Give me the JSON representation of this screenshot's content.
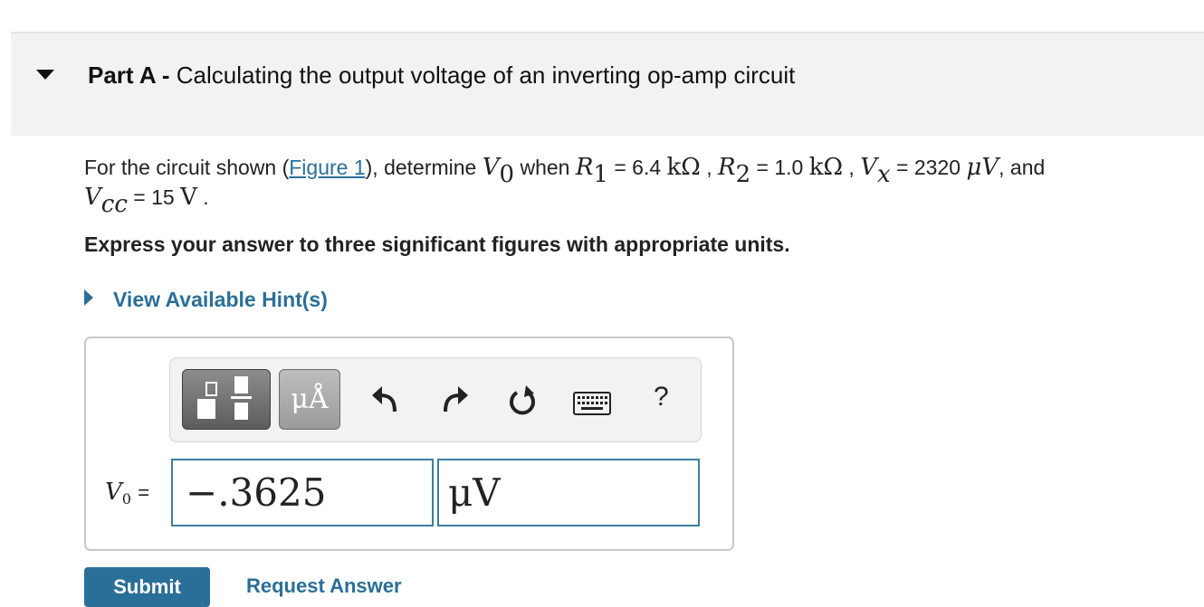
{
  "part": {
    "label": "Part A -",
    "title": "Calculating the output voltage of an inverting op-amp circuit"
  },
  "problem": {
    "line1_prefix": "For the circuit shown (",
    "figure_link": "Figure 1",
    "line1_mid": "), determine",
    "v0": "V",
    "v0_sub": "0",
    "when": "when",
    "r1": "R",
    "r1_sub": "1",
    "r1_value": "= 6.4",
    "r1_unit": "kΩ",
    "sep1": ",",
    "r2": "R",
    "r2_sub": "2",
    "r2_value": "= 1.0",
    "r2_unit": "kΩ",
    "sep2": ",",
    "vx": "V",
    "vx_sub": "x",
    "vx_value": "= 2320",
    "vx_unit": "μV",
    "and": ", and",
    "vcc": "V",
    "vcc_sub": "cc",
    "vcc_value": "= 15",
    "vcc_unit": "V",
    "end": "."
  },
  "instructions": "Express your answer to three significant figures with appropriate units.",
  "hint_link": "View Available Hint(s)",
  "toolbar": {
    "units_label": "μÅ",
    "help_label": "?",
    "icons": [
      "templates-icon",
      "units-icon",
      "undo-icon",
      "redo-icon",
      "reset-icon",
      "keyboard-icon",
      "help-icon"
    ]
  },
  "answer": {
    "var": "V",
    "var_sub": "0",
    "equals": "=",
    "value": "−.3625",
    "unit": "μV"
  },
  "buttons": {
    "submit": "Submit",
    "request": "Request Answer"
  },
  "colors": {
    "link": "#2a6f98",
    "header_bg": "#f2f2f2",
    "field_border": "#3a7f9e"
  }
}
